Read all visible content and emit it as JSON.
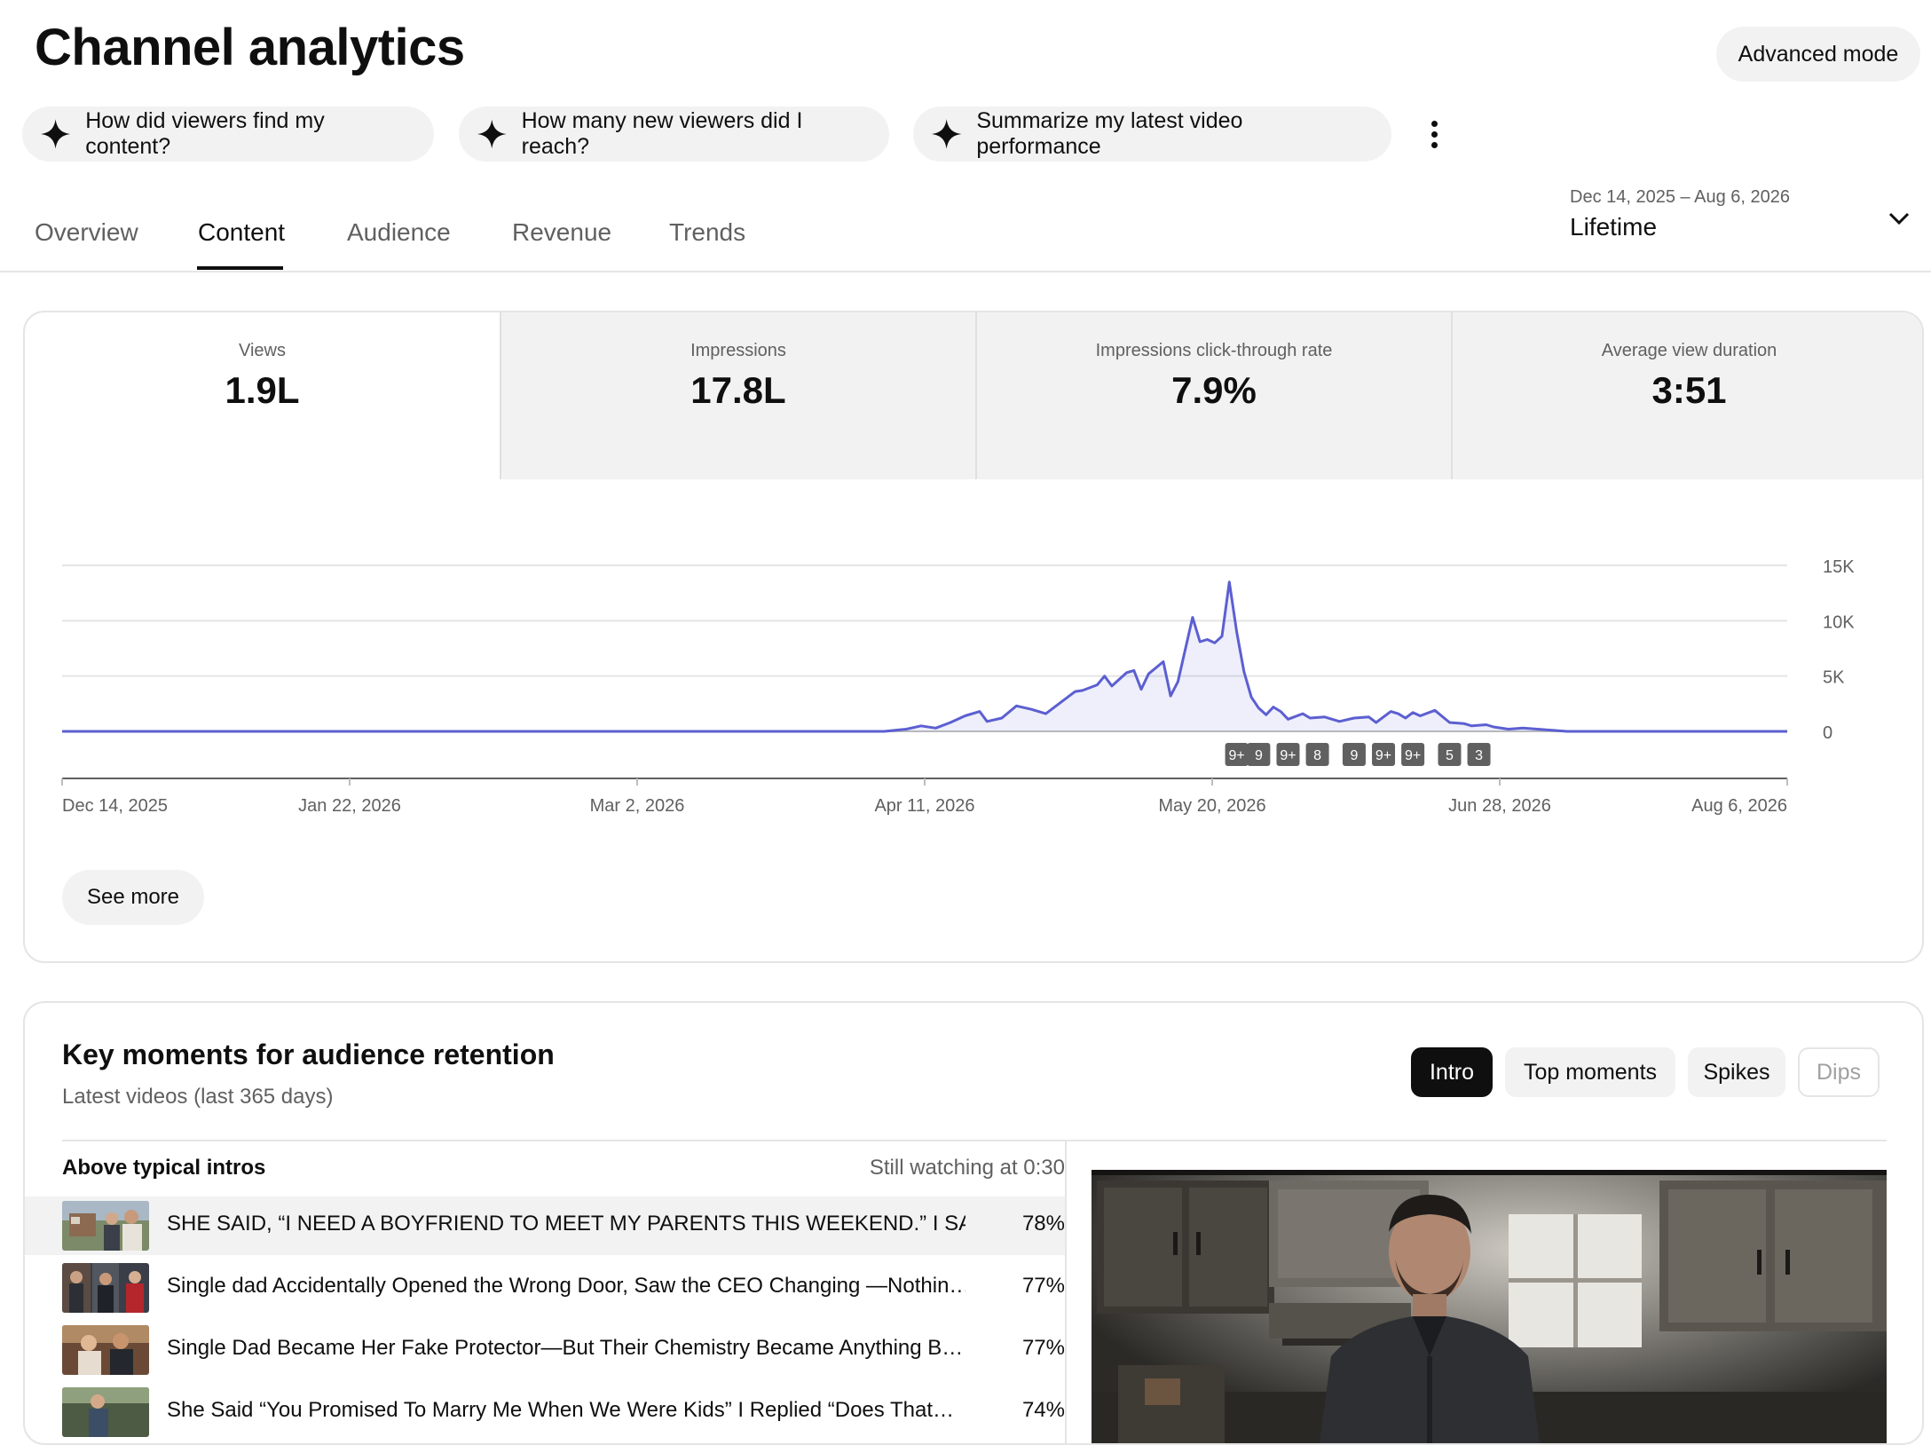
{
  "header": {
    "title": "Channel analytics",
    "advanced_mode_label": "Advanced mode"
  },
  "suggestions": [
    {
      "label": "How did viewers find my content?",
      "icon": "sparkle-icon"
    },
    {
      "label": "How many new viewers did I reach?",
      "icon": "sparkle-icon"
    },
    {
      "label": "Summarize my latest video performance",
      "icon": "sparkle-icon"
    }
  ],
  "tabs": [
    {
      "label": "Overview",
      "active": false
    },
    {
      "label": "Content",
      "active": true
    },
    {
      "label": "Audience",
      "active": false
    },
    {
      "label": "Revenue",
      "active": false
    },
    {
      "label": "Trends",
      "active": false
    }
  ],
  "date_picker": {
    "range": "Dec 14, 2025 – Aug 6, 2026",
    "period": "Lifetime"
  },
  "metrics": [
    {
      "label": "Views",
      "value": "1.9L",
      "selected": true
    },
    {
      "label": "Impressions",
      "value": "17.8L",
      "selected": false
    },
    {
      "label": "Impressions click-through rate",
      "value": "7.9%",
      "selected": false
    },
    {
      "label": "Average view duration",
      "value": "3:51",
      "selected": false
    }
  ],
  "chart_data": {
    "type": "area",
    "title": "",
    "xlabel": "",
    "ylabel": "",
    "ylim": [
      0,
      15000
    ],
    "y_ticks": [
      "15K",
      "10K",
      "5K",
      "0"
    ],
    "y_tick_values": [
      15000,
      10000,
      5000,
      0
    ],
    "x_tick_labels": [
      "Dec 14, 2025",
      "Jan 22, 2026",
      "Mar 2, 2026",
      "Apr 11, 2026",
      "May 20, 2026",
      "Jun 28, 2026",
      "Aug 6, 2026"
    ],
    "x_range": [
      "2025-12-14",
      "2026-08-06"
    ],
    "grid": true,
    "color": "#5c5fd1",
    "series": [
      {
        "values": [
          [
            "2025-12-14",
            0
          ],
          [
            "2026-04-05",
            0
          ],
          [
            "2026-04-08",
            200
          ],
          [
            "2026-04-10",
            500
          ],
          [
            "2026-04-12",
            300
          ],
          [
            "2026-04-14",
            800
          ],
          [
            "2026-04-16",
            1400
          ],
          [
            "2026-04-18",
            1800
          ],
          [
            "2026-04-19",
            900
          ],
          [
            "2026-04-21",
            1200
          ],
          [
            "2026-04-23",
            2300
          ],
          [
            "2026-04-25",
            2000
          ],
          [
            "2026-04-27",
            1600
          ],
          [
            "2026-04-29",
            2600
          ],
          [
            "2026-05-01",
            3600
          ],
          [
            "2026-05-02",
            3700
          ],
          [
            "2026-05-04",
            4200
          ],
          [
            "2026-05-05",
            5000
          ],
          [
            "2026-05-06",
            4100
          ],
          [
            "2026-05-08",
            5300
          ],
          [
            "2026-05-09",
            5500
          ],
          [
            "2026-05-10",
            3800
          ],
          [
            "2026-05-11",
            5200
          ],
          [
            "2026-05-13",
            6300
          ],
          [
            "2026-05-14",
            3200
          ],
          [
            "2026-05-15",
            4500
          ],
          [
            "2026-05-17",
            10300
          ],
          [
            "2026-05-18",
            8100
          ],
          [
            "2026-05-19",
            8300
          ],
          [
            "2026-05-20",
            8000
          ],
          [
            "2026-05-21",
            8600
          ],
          [
            "2026-05-22",
            13500
          ],
          [
            "2026-05-23",
            9000
          ],
          [
            "2026-05-24",
            5400
          ],
          [
            "2026-05-25",
            3100
          ],
          [
            "2026-05-26",
            2100
          ],
          [
            "2026-05-27",
            1500
          ],
          [
            "2026-05-28",
            2200
          ],
          [
            "2026-05-29",
            1800
          ],
          [
            "2026-05-30",
            1100
          ],
          [
            "2026-06-01",
            1600
          ],
          [
            "2026-06-02",
            1200
          ],
          [
            "2026-06-04",
            1300
          ],
          [
            "2026-06-06",
            900
          ],
          [
            "2026-06-08",
            1200
          ],
          [
            "2026-06-10",
            1300
          ],
          [
            "2026-06-11",
            800
          ],
          [
            "2026-06-13",
            1800
          ],
          [
            "2026-06-14",
            1600
          ],
          [
            "2026-06-15",
            1200
          ],
          [
            "2026-06-16",
            1700
          ],
          [
            "2026-06-17",
            1400
          ],
          [
            "2026-06-19",
            1900
          ],
          [
            "2026-06-21",
            800
          ],
          [
            "2026-06-23",
            700
          ],
          [
            "2026-06-24",
            500
          ],
          [
            "2026-06-26",
            600
          ],
          [
            "2026-06-27",
            400
          ],
          [
            "2026-06-29",
            200
          ],
          [
            "2026-07-01",
            300
          ],
          [
            "2026-07-03",
            200
          ],
          [
            "2026-07-05",
            100
          ],
          [
            "2026-07-07",
            0
          ],
          [
            "2026-08-06",
            0
          ]
        ]
      }
    ],
    "markers": [
      {
        "label": "9+",
        "date": "2026-05-23"
      },
      {
        "label": "9",
        "date": "2026-05-26"
      },
      {
        "label": "9+",
        "date": "2026-05-30"
      },
      {
        "label": "8",
        "date": "2026-06-03"
      },
      {
        "label": "9",
        "date": "2026-06-08"
      },
      {
        "label": "9+",
        "date": "2026-06-12"
      },
      {
        "label": "9+",
        "date": "2026-06-16"
      },
      {
        "label": "5",
        "date": "2026-06-21"
      },
      {
        "label": "3",
        "date": "2026-06-25"
      }
    ]
  },
  "see_more_label": "See more",
  "key_moments": {
    "title": "Key moments for audience retention",
    "subtitle": "Latest videos (last 365 days)",
    "filters": [
      {
        "label": "Intro",
        "state": "active"
      },
      {
        "label": "Top moments",
        "state": "normal"
      },
      {
        "label": "Spikes",
        "state": "normal"
      },
      {
        "label": "Dips",
        "state": "disabled"
      }
    ],
    "list_header": "Above typical intros",
    "list_header_right": "Still watching at 0:30",
    "rows": [
      {
        "title": "SHE SAID, “I NEED A BOYFRIEND TO MEET MY PARENTS THIS WEEKEND.” I SAID, …",
        "pct": "78%"
      },
      {
        "title": "Single dad Accidentally Opened the Wrong Door, Saw the CEO Changing —Nothin…",
        "pct": "77%"
      },
      {
        "title": "Single Dad Became Her Fake Protector—But Their Chemistry Became Anything B…",
        "pct": "77%"
      },
      {
        "title": "She Said “You Promised To Marry Me When We Were Kids” I Replied “Does That…",
        "pct": "74%"
      }
    ]
  },
  "colors": {
    "accent": "#5c5fd1",
    "text_primary": "#0f0f0f",
    "text_secondary": "#606060",
    "chip_bg": "#f2f2f2"
  }
}
